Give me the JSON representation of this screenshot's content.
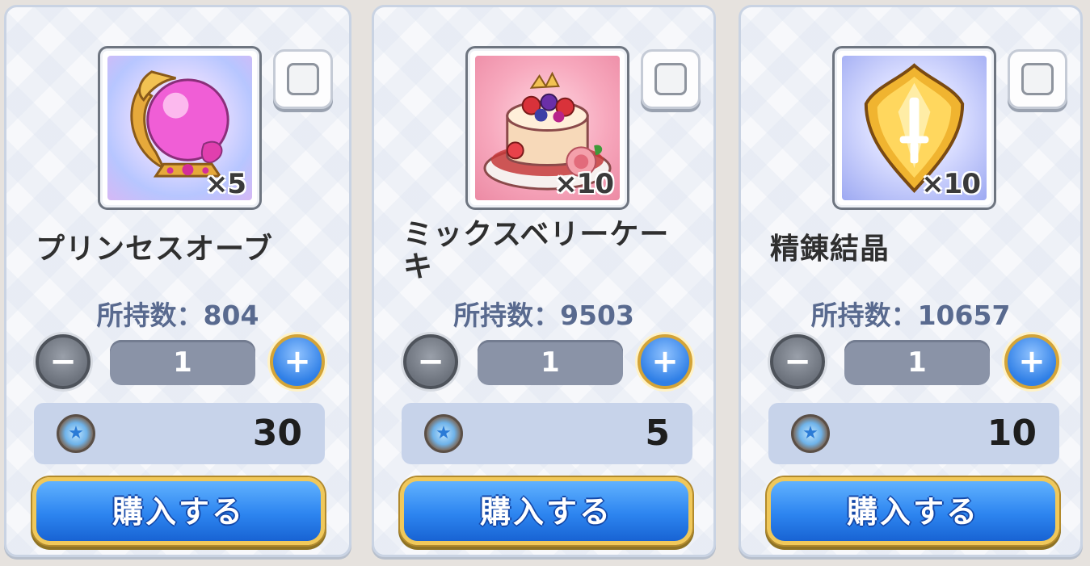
{
  "shop": {
    "items": [
      {
        "name": "プリンセスオーブ",
        "icon": "princess-orb-icon",
        "quantity_badge": "×5",
        "owned_text": "所持数：804",
        "selected_quantity": "1",
        "price": "30",
        "buy_label": "購入する",
        "checked": false
      },
      {
        "name": "ミックスベリーケーキ",
        "icon": "mixed-berry-cake-icon",
        "quantity_badge": "×10",
        "owned_text": "所持数：9503",
        "selected_quantity": "1",
        "price": "5",
        "buy_label": "購入する",
        "checked": false
      },
      {
        "name": "精錬結晶",
        "icon": "refining-crystal-icon",
        "quantity_badge": "×10",
        "owned_text": "所持数：10657",
        "selected_quantity": "1",
        "price": "10",
        "buy_label": "購入する",
        "checked": false
      }
    ],
    "currency_icon": "coin-icon",
    "minus_symbol": "−",
    "plus_symbol": "+",
    "colors": {
      "buy_button": "#2d85f0",
      "buy_button_border": "#f0c85a",
      "owned_text": "#596a8f",
      "quantity_field": "#8a93a7",
      "price_box": "#c7d3ea"
    }
  }
}
